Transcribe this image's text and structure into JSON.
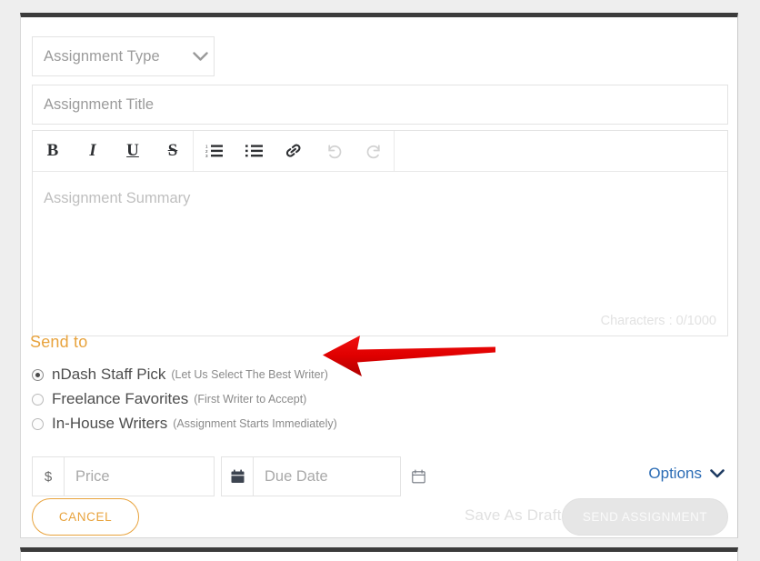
{
  "form": {
    "assignment_type": {
      "placeholder": "Assignment Type",
      "value": ""
    },
    "assignment_title": {
      "placeholder": "Assignment Title",
      "value": ""
    },
    "assignment_summary": {
      "placeholder": "Assignment Summary",
      "value": ""
    },
    "character_counter": "Characters : 0/1000"
  },
  "toolbar": {
    "bold": "B",
    "italic": "I",
    "underline": "U",
    "strikethrough": "S"
  },
  "send_to": {
    "label": "Send to",
    "options": [
      {
        "label": "nDash Staff Pick",
        "note": "(Let Us Select The Best Writer)",
        "selected": true
      },
      {
        "label": "Freelance Favorites",
        "note": "(First Writer to Accept)",
        "selected": false
      },
      {
        "label": "In-House Writers",
        "note": "(Assignment Starts Immediately)",
        "selected": false
      }
    ]
  },
  "price": {
    "prefix": "$",
    "placeholder": "Price",
    "value": ""
  },
  "due_date": {
    "placeholder": "Due Date",
    "value": ""
  },
  "options": {
    "label": "Options"
  },
  "actions": {
    "cancel": "CANCEL",
    "save_draft": "Save As Draft",
    "send": "SEND ASSIGNMENT"
  },
  "colors": {
    "accent_orange": "#e8a33d",
    "link_blue": "#2b6cb5",
    "annotation_red": "#e00000",
    "card_top_bar": "#3b3b3b"
  }
}
